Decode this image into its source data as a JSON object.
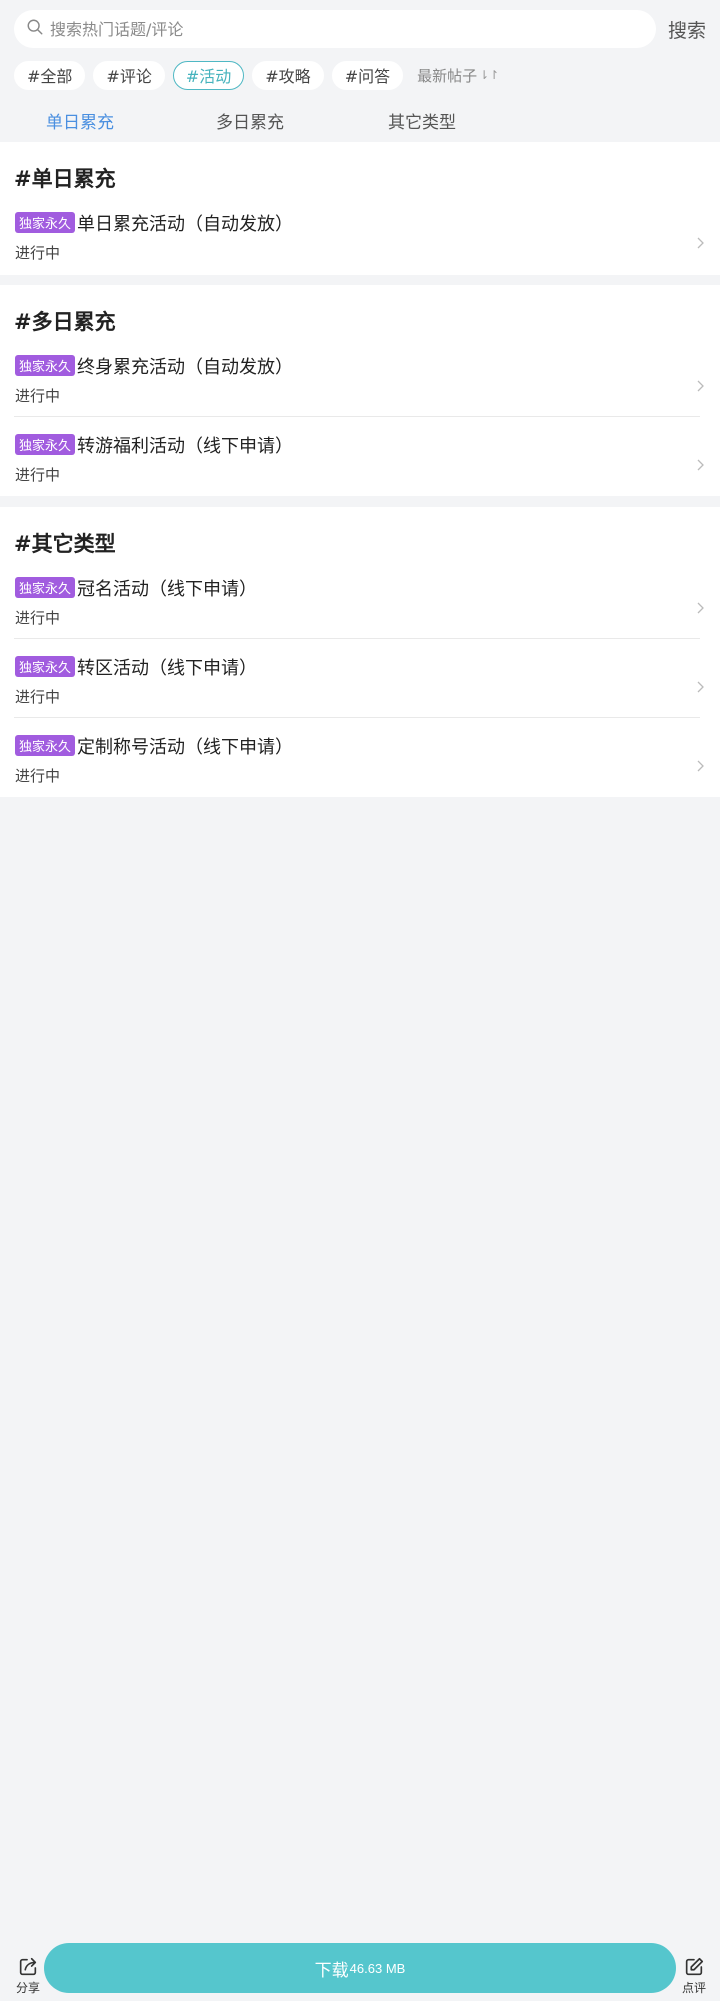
{
  "search": {
    "placeholder": "搜索热门话题/评论",
    "button_label": "搜索"
  },
  "chips": [
    {
      "label": "#全部"
    },
    {
      "label": "#评论"
    },
    {
      "label": "#活动"
    },
    {
      "label": "#攻略"
    },
    {
      "label": "#问答"
    }
  ],
  "sort_label": "最新帖子",
  "tabs": [
    {
      "label": "单日累充"
    },
    {
      "label": "多日累充"
    },
    {
      "label": "其它类型"
    }
  ],
  "sections": [
    {
      "title": "#单日累充",
      "items": [
        {
          "badge": "独家永久",
          "title": "单日累充活动（自动发放）",
          "status": "进行中"
        }
      ]
    },
    {
      "title": "#多日累充",
      "items": [
        {
          "badge": "独家永久",
          "title": "终身累充活动（自动发放）",
          "status": "进行中"
        },
        {
          "badge": "独家永久",
          "title": "转游福利活动（线下申请）",
          "status": "进行中"
        }
      ]
    },
    {
      "title": "#其它类型",
      "items": [
        {
          "badge": "独家永久",
          "title": "冠名活动（线下申请）",
          "status": "进行中"
        },
        {
          "badge": "独家永久",
          "title": "转区活动（线下申请）",
          "status": "进行中"
        },
        {
          "badge": "独家永久",
          "title": "定制称号活动（线下申请）",
          "status": "进行中"
        }
      ]
    }
  ],
  "bottom": {
    "share_label": "分享",
    "download_label": "下载",
    "download_size": "46.63 MB",
    "review_label": "点评"
  },
  "colors": {
    "accent_teal": "#55c6cd",
    "active_tab_blue": "#4a8fe0",
    "badge_purple": "#a15cdf",
    "background": "#f3f4f6"
  },
  "icons": {
    "search": "search-icon",
    "chevron": "chevron-right-icon",
    "share": "share-icon",
    "review": "edit-icon"
  }
}
